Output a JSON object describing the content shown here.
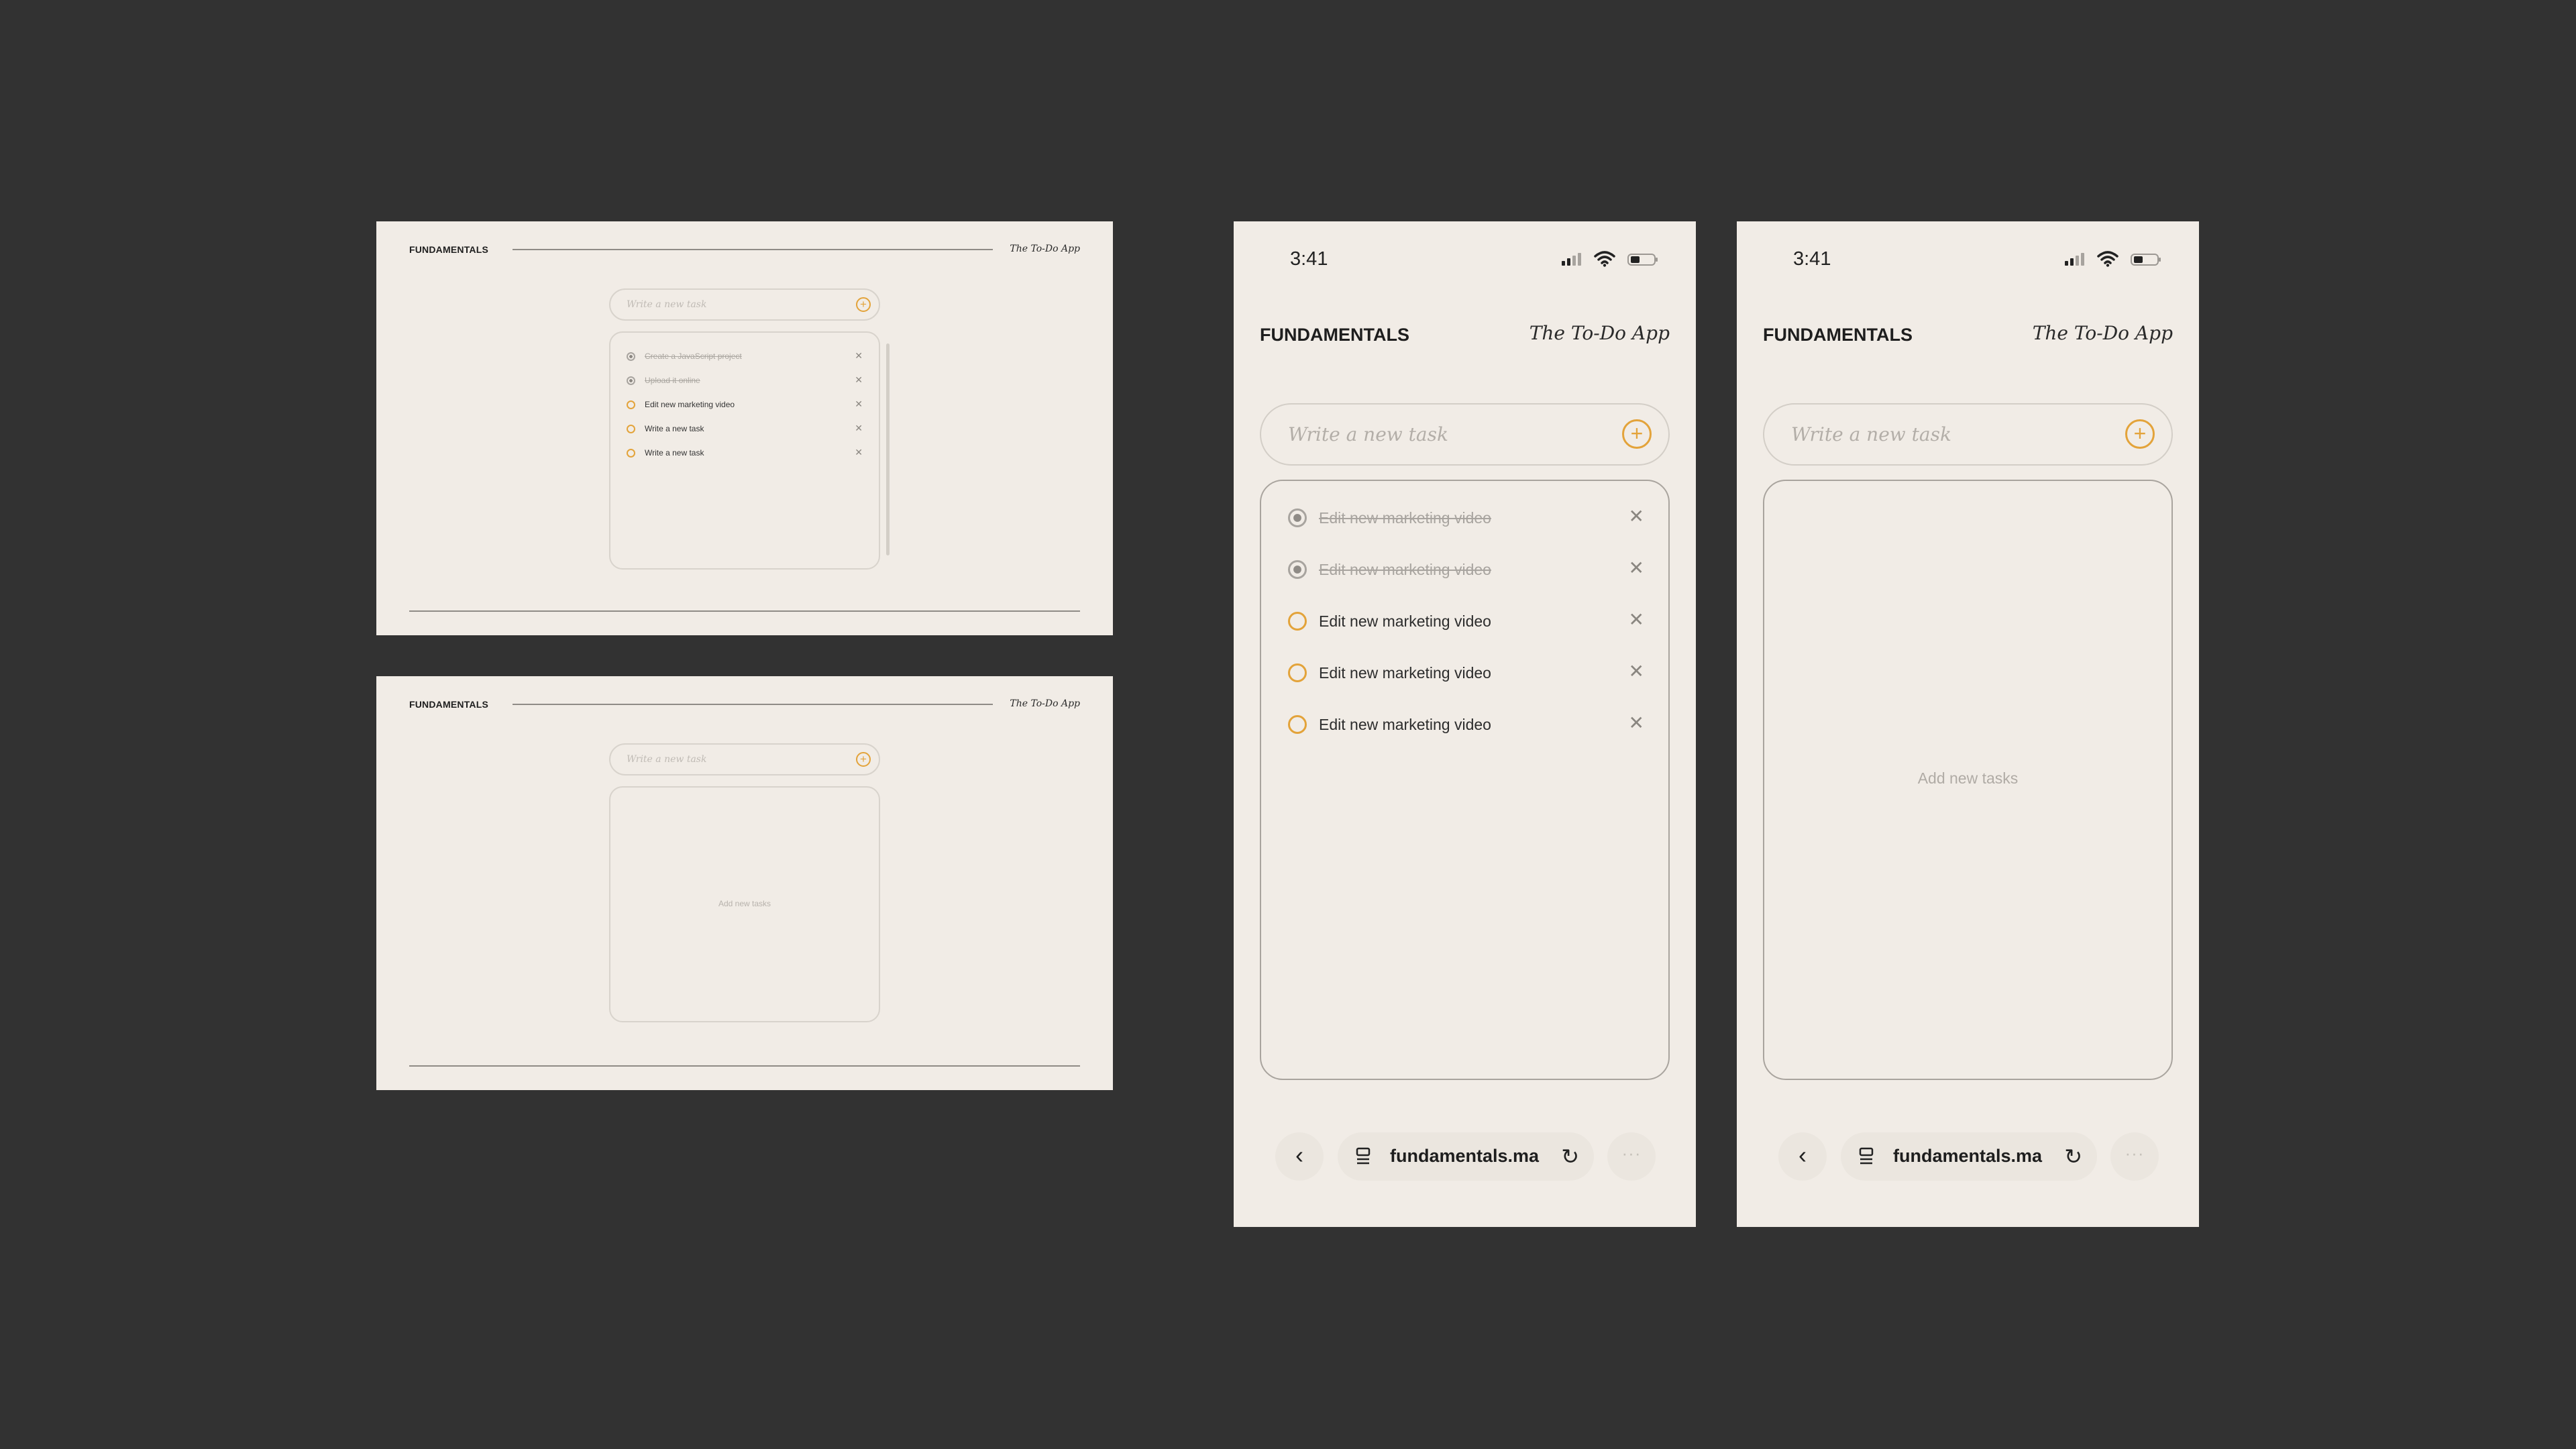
{
  "brand": "FUNDAMENTALS",
  "app_name": "The To-Do App",
  "input": {
    "placeholder": "Write a new task",
    "add_icon": "plus-circle-icon"
  },
  "empty_state": "Add new tasks",
  "desktop_tasks": [
    {
      "text": "Create a JavaScript project",
      "done": true
    },
    {
      "text": "Upload it online",
      "done": true
    },
    {
      "text": "Edit new marketing video",
      "done": false
    },
    {
      "text": "Write a new task",
      "done": false
    },
    {
      "text": "Write a new task",
      "done": false
    }
  ],
  "mobile_tasks": [
    {
      "text": "Edit new marketing video",
      "done": true
    },
    {
      "text": "Edit new marketing video",
      "done": true
    },
    {
      "text": "Edit new marketing video",
      "done": false
    },
    {
      "text": "Edit new marketing video",
      "done": false
    },
    {
      "text": "Edit new marketing video",
      "done": false
    }
  ],
  "status_bar": {
    "time": "3:41"
  },
  "browser": {
    "url": "fundamentals.ma",
    "more": "···"
  },
  "delete_glyph": "✕",
  "colors": {
    "accent": "#e3a33a",
    "background": "#323232",
    "surface": "#f1ece6"
  }
}
